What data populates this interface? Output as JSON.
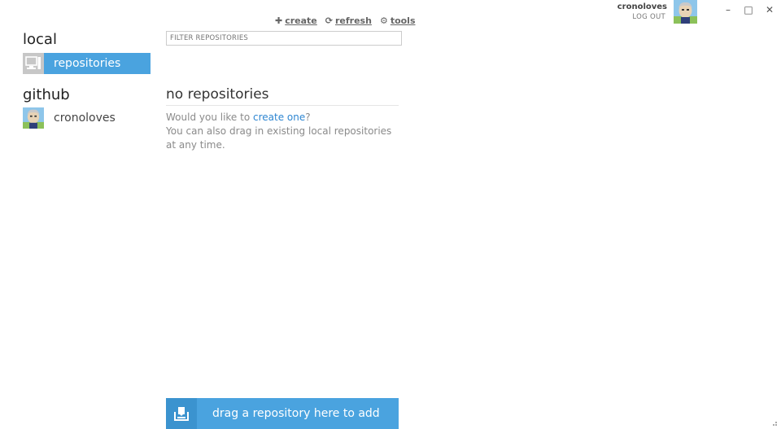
{
  "toolbar": {
    "create": "create",
    "refresh": "refresh",
    "tools": "tools"
  },
  "account": {
    "username": "cronoloves",
    "logout": "LOG OUT"
  },
  "window": {
    "minimize": "–",
    "maximize": "□",
    "close": "✕"
  },
  "sidebar": {
    "local_title": "local",
    "local_item": "repositories",
    "github_title": "github",
    "github_item": "cronoloves"
  },
  "filter": {
    "placeholder": "FILTER REPOSITORIES"
  },
  "main": {
    "title": "no repositories",
    "question_prefix": "Would you like to ",
    "question_link": "create one",
    "question_suffix": "?",
    "drag_hint": "You can also drag in existing local repositories at any time."
  },
  "dropzone": {
    "label": "drag a repository here to add"
  },
  "colors": {
    "accent": "#4aa3df",
    "link": "#2e86d1"
  },
  "icons": {
    "create": "plus-icon",
    "refresh": "refresh-icon",
    "tools": "gear-icon",
    "local": "computer-icon",
    "dropzone": "download-box-icon"
  }
}
